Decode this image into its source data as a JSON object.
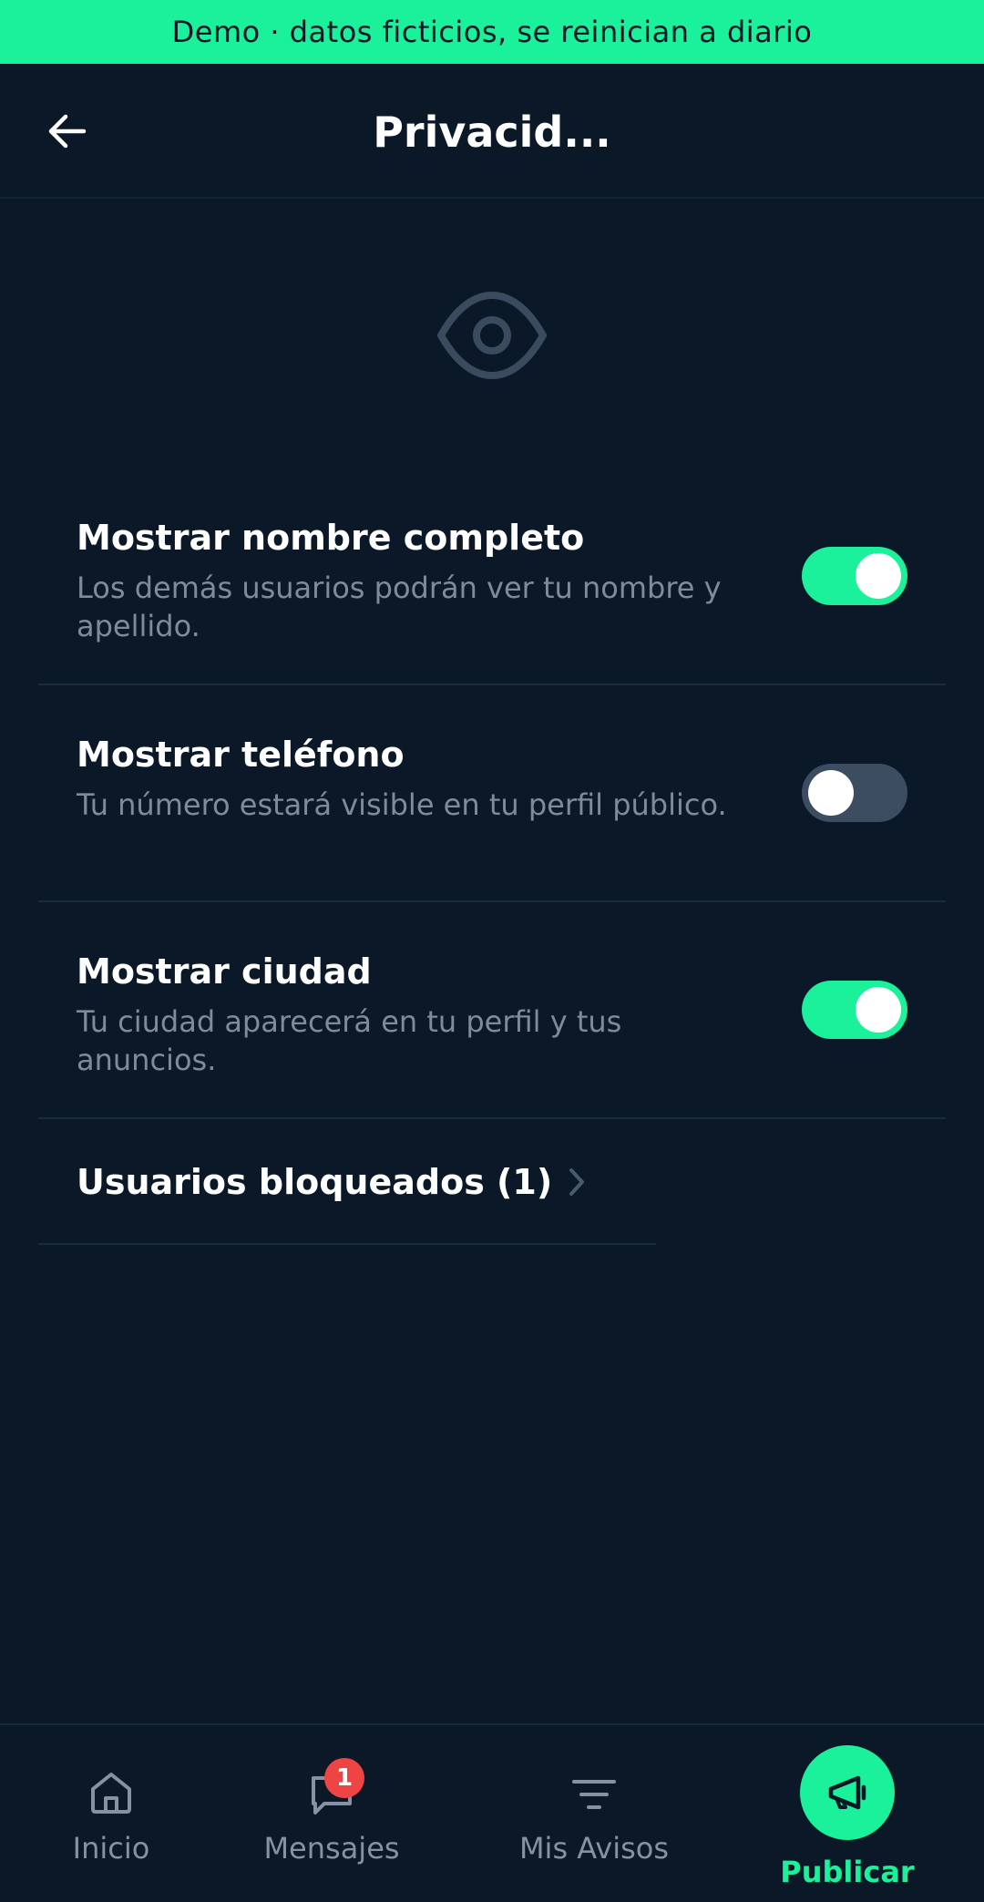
{
  "banner": {
    "text": "Demo · datos ficticios, se reinician a diario"
  },
  "header": {
    "title": "Privacid..."
  },
  "settings": [
    {
      "title": "Mostrar nombre completo",
      "description": "Los demás usuarios podrán ver tu nombre y apellido.",
      "enabled": true
    },
    {
      "title": "Mostrar teléfono",
      "description": "Tu número estará visible en tu perfil público.",
      "enabled": false
    },
    {
      "title": "Mostrar ciudad",
      "description": "Tu ciudad aparecerá en tu perfil y tus anuncios.",
      "enabled": true
    }
  ],
  "blocked_users": {
    "label": "Usuarios bloqueados (1)"
  },
  "nav": {
    "items": [
      {
        "label": "Inicio",
        "icon": "home-icon"
      },
      {
        "label": "Mensajes",
        "icon": "chat-icon",
        "badge": "1"
      },
      {
        "label": "Mis Avisos",
        "icon": "filter-icon"
      },
      {
        "label": "Publicar",
        "icon": "megaphone-icon",
        "active": true
      }
    ]
  },
  "colors": {
    "background": "#0a1828",
    "accent": "#1bf09a",
    "toggle_off": "#3c4d62",
    "text_secondary": "#7f8b99",
    "badge": "#ef4444"
  }
}
